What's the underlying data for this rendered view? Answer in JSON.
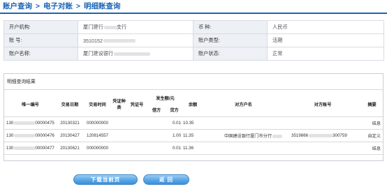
{
  "breadcrumb": {
    "items": [
      "账户查询",
      "电子对账",
      "明细账查询"
    ],
    "separator": ">"
  },
  "account_info": {
    "rows": [
      [
        {
          "label": "开户机构:",
          "value": "厦门建行",
          "value_tail": "支行"
        },
        {
          "label": "币  种:",
          "value": "人民币"
        }
      ],
      [
        {
          "label": "账  号:",
          "value": "3510152",
          "value_tail": ""
        },
        {
          "label": "账户类型:",
          "value": "活期"
        }
      ],
      [
        {
          "label": "账户名称:",
          "value": "厦门建设银行",
          "value_tail": ""
        },
        {
          "label": "账户状态:",
          "value": "正常"
        }
      ]
    ]
  },
  "results": {
    "title": "明细查询结果",
    "headers": {
      "serial": "唯一编号",
      "date": "交易日期",
      "time": "交易时间",
      "voucher_type": "凭证种类",
      "voucher_no": "凭证号",
      "amount": "发生额/元",
      "debit": "借方",
      "credit": "贷方",
      "balance": "余额",
      "counterparty_name": "对方户名",
      "counterparty_account": "对方账号",
      "summary": "摘要"
    },
    "rows": [
      {
        "serial_prefix": "130",
        "serial_suffix": "00000475",
        "date": "20130321",
        "time": "000000000",
        "voucher_type": "",
        "voucher_no": "",
        "debit": "",
        "credit": "0.01",
        "balance": "10.35",
        "counterparty_name": "",
        "counterparty_account_prefix": "",
        "counterparty_account_suffix": "",
        "summary": "结息"
      },
      {
        "serial_prefix": "130",
        "serial_suffix": "00000476",
        "date": "20130427",
        "time": "120814557",
        "voucher_type": "",
        "voucher_no": "",
        "debit": "",
        "credit": "1.00",
        "balance": "11.35",
        "counterparty_name": "中国建设银行厦门市分行",
        "counterparty_account_prefix": "3519866",
        "counterparty_account_suffix": "300759",
        "summary": "自定义"
      },
      {
        "serial_prefix": "130",
        "serial_suffix": "00000477",
        "date": "20130621",
        "time": "000000000",
        "voucher_type": "",
        "voucher_no": "",
        "debit": "",
        "credit": "0.01",
        "balance": "11.36",
        "counterparty_name": "",
        "counterparty_account_prefix": "",
        "counterparty_account_suffix": "",
        "summary": "结息"
      }
    ]
  },
  "buttons": {
    "download": "下载当前页",
    "back": "返 回"
  },
  "colors": {
    "accent": "#1a64b4",
    "label_bg": "#edf0f4",
    "button": "#5aa6e6"
  }
}
